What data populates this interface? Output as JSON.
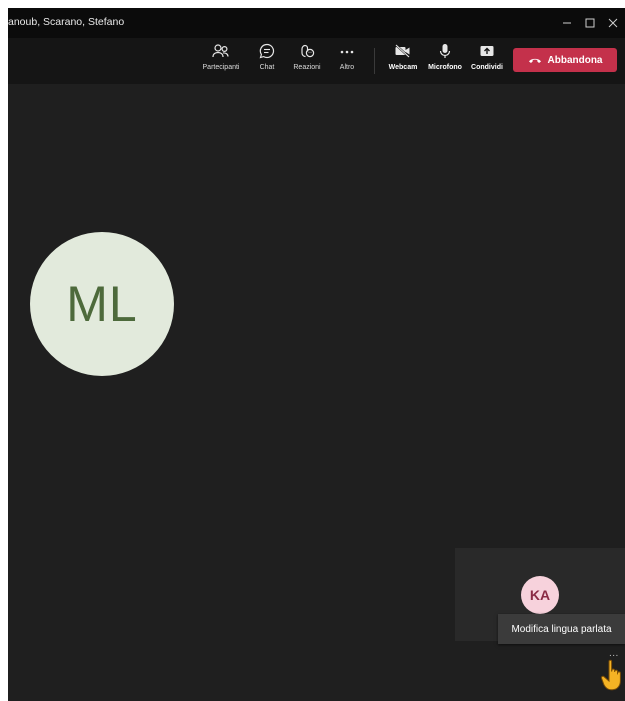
{
  "window": {
    "title": "anoub, Scarano, Stefano",
    "controls": [
      "minimize",
      "maximize",
      "close"
    ]
  },
  "toolbar": {
    "items": [
      {
        "label": "Partecipanti",
        "icon": "participants-icon"
      },
      {
        "label": "Chat",
        "icon": "chat-icon"
      },
      {
        "label": "Reazioni",
        "icon": "reactions-icon"
      },
      {
        "label": "Altro",
        "icon": "more-icon"
      },
      {
        "label": "Webcam",
        "icon": "webcam-off-icon"
      },
      {
        "label": "Microfono",
        "icon": "microphone-icon"
      },
      {
        "label": "Condividi",
        "icon": "share-icon"
      }
    ],
    "leave_label": "Abbandona",
    "leave_color": "#c4314b"
  },
  "stage": {
    "main_participant": {
      "initials": "ML",
      "avatar_color": "#e2eadc",
      "text_color": "#4d6a3b"
    },
    "tile_participant": {
      "initials": "KA",
      "avatar_color": "#f7d2dc",
      "text_color": "#8a2a44"
    },
    "tooltip": "Modifica lingua parlata",
    "more_options": "..."
  }
}
